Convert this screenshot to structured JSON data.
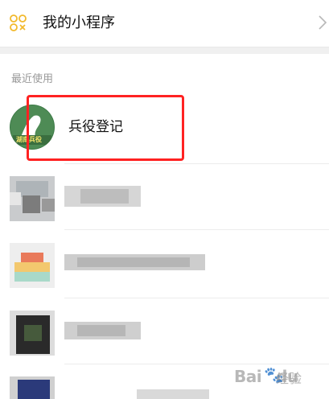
{
  "header": {
    "title": "我的小程序",
    "icon": "mini-program-icon",
    "chevron": "chevron-right-icon"
  },
  "recent": {
    "section_label": "最近使用",
    "items": [
      {
        "label": "兵役登记",
        "avatar_text": "湖南兵役",
        "highlighted": true
      },
      {
        "label": "",
        "blurred": true
      },
      {
        "label": "",
        "blurred": true
      },
      {
        "label": "",
        "blurred": true
      },
      {
        "label": "",
        "blurred": true
      }
    ]
  },
  "watermark": {
    "brand": "Bai",
    "brand_rest": "du",
    "sub": "经验"
  },
  "colors": {
    "accent_yellow": "#f2b92c",
    "highlight_red": "#ff2222",
    "avatar_green": "#3c7a46"
  }
}
